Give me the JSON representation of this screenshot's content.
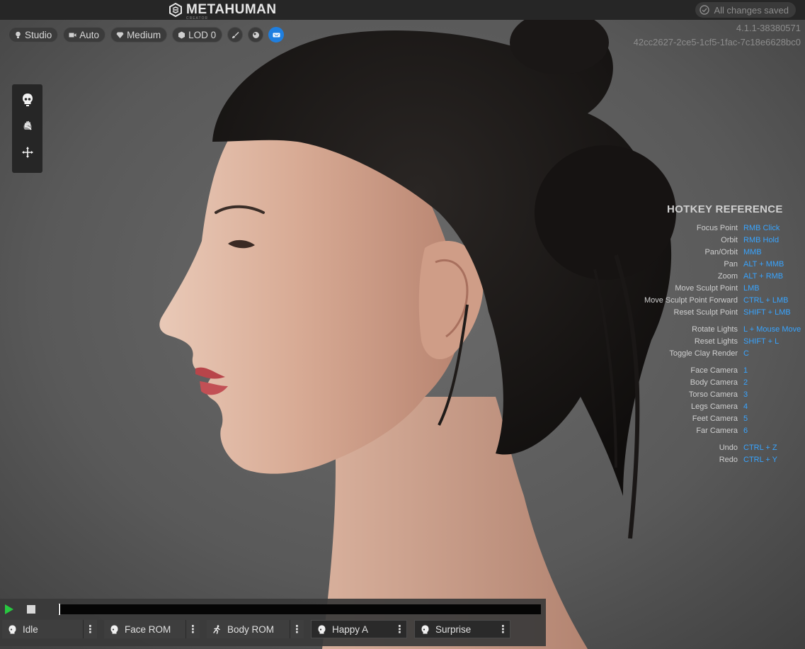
{
  "app": {
    "logo_text": "METAHUMAN",
    "logo_sub": "CREATOR",
    "save_status": "All changes saved",
    "build_version": "4.1.1-38380571",
    "build_hash": "42cc2627-2ce5-1cf5-1fac-7c18e6628bc0"
  },
  "toolbar": {
    "lighting_label": "Studio",
    "camera_label": "Auto",
    "quality_label": "Medium",
    "lod_label": "LOD 0",
    "icons": [
      "light-bulb-icon",
      "camera-icon",
      "diamond-icon",
      "cube-icon",
      "brush-icon",
      "sphere-icon",
      "keyboard-icon"
    ]
  },
  "tools": {
    "icons": [
      "skull-icon",
      "sculpt-icon",
      "move-arrows-icon"
    ]
  },
  "hotkeys": {
    "title": "HOTKEY REFERENCE",
    "groups": [
      [
        {
          "label": "Focus Point",
          "key": "RMB Click"
        },
        {
          "label": "Orbit",
          "key": "RMB Hold"
        },
        {
          "label": "Pan/Orbit",
          "key": "MMB"
        },
        {
          "label": "Pan",
          "key": "ALT + MMB"
        },
        {
          "label": "Zoom",
          "key": "ALT + RMB"
        },
        {
          "label": "Move Sculpt Point",
          "key": "LMB"
        },
        {
          "label": "Move Sculpt Point Forward",
          "key": "CTRL + LMB"
        },
        {
          "label": "Reset Sculpt Point",
          "key": "SHIFT + LMB"
        }
      ],
      [
        {
          "label": "Rotate Lights",
          "key": "L + Mouse Move"
        },
        {
          "label": "Reset Lights",
          "key": "SHIFT + L"
        },
        {
          "label": "Toggle Clay Render",
          "key": "C"
        }
      ],
      [
        {
          "label": "Face Camera",
          "key": "1"
        },
        {
          "label": "Body Camera",
          "key": "2"
        },
        {
          "label": "Torso Camera",
          "key": "3"
        },
        {
          "label": "Legs Camera",
          "key": "4"
        },
        {
          "label": "Feet Camera",
          "key": "5"
        },
        {
          "label": "Far Camera",
          "key": "6"
        }
      ],
      [
        {
          "label": "Undo",
          "key": "CTRL + Z"
        },
        {
          "label": "Redo",
          "key": "CTRL + Y"
        }
      ]
    ]
  },
  "animation": {
    "playback_progress": 0.0,
    "clips": [
      {
        "label": "Idle",
        "icon": "head-icon",
        "selected": false
      },
      {
        "label": "Face ROM",
        "icon": "head-icon",
        "selected": false
      },
      {
        "label": "Body ROM",
        "icon": "running-figure-icon",
        "selected": false
      },
      {
        "label": "Happy A",
        "icon": "head-icon",
        "selected": true
      },
      {
        "label": "Surprise",
        "icon": "head-icon",
        "selected": true
      }
    ]
  },
  "colors": {
    "accent": "#38a4ff",
    "active_button": "#1f7fe0",
    "play_green": "#28c840"
  }
}
